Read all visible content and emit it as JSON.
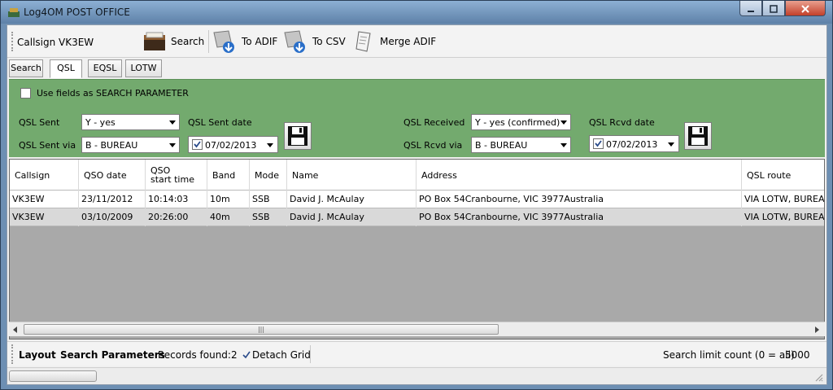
{
  "window": {
    "title": "Log4OM POST OFFICE"
  },
  "toolbar": {
    "callsign_label": "Callsign",
    "callsign_value": "VK3EW",
    "search_label": "Search",
    "to_adif_label": "To ADIF",
    "to_csv_label": "To CSV",
    "merge_adif_label": "Merge ADIF"
  },
  "tabs": [
    "Search",
    "QSL",
    "EQSL",
    "LOTW"
  ],
  "params": {
    "use_fields_label": "Use fields as SEARCH PARAMETER",
    "qsl_sent_label": "QSL Sent",
    "qsl_sent_value": "Y - yes",
    "qsl_sent_via_label": "QSL Sent via",
    "qsl_sent_via_value": "B - BUREAU",
    "qsl_sent_date_label": "QSL Sent date",
    "qsl_sent_date_value": "07/02/2013",
    "qsl_received_label": "QSL Received",
    "qsl_received_value": "Y - yes (confirmed)",
    "qsl_rcvd_via_label": "QSL Rcvd via",
    "qsl_rcvd_via_value": "B - BUREAU",
    "qsl_rcvd_date_label": "QSL Rcvd date",
    "qsl_rcvd_date_value": "07/02/2013"
  },
  "grid": {
    "columns": [
      "Callsign",
      "QSO date",
      "QSO\nstart time",
      "Band",
      "Mode",
      "Name",
      "Address",
      "QSL route"
    ],
    "rows": [
      [
        "VK3EW",
        "23/11/2012",
        "10:14:03",
        "10m",
        "SSB",
        "David J. McAulay",
        "PO Box 54Cranbourne, VIC 3977Australia",
        "VIA LOTW, BUREAU"
      ],
      [
        "VK3EW",
        "03/10/2009",
        "20:26:00",
        "40m",
        "SSB",
        "David J. McAulay",
        "PO Box 54Cranbourne, VIC 3977Australia",
        "VIA LOTW, BUREAU"
      ]
    ]
  },
  "status": {
    "layout_label": "Layout",
    "search_params_label": "Search Parameters",
    "records_found_label": "Records found:",
    "records_found_value": "2",
    "detach_grid_label": "Detach Grid",
    "search_limit_label": "Search limit count (0 = all)",
    "search_limit_value": "5000"
  },
  "colors": {
    "param_panel": "#73aa6e",
    "grid_bg": "#a9a9a9",
    "selected_row": "#d9d9d9"
  }
}
